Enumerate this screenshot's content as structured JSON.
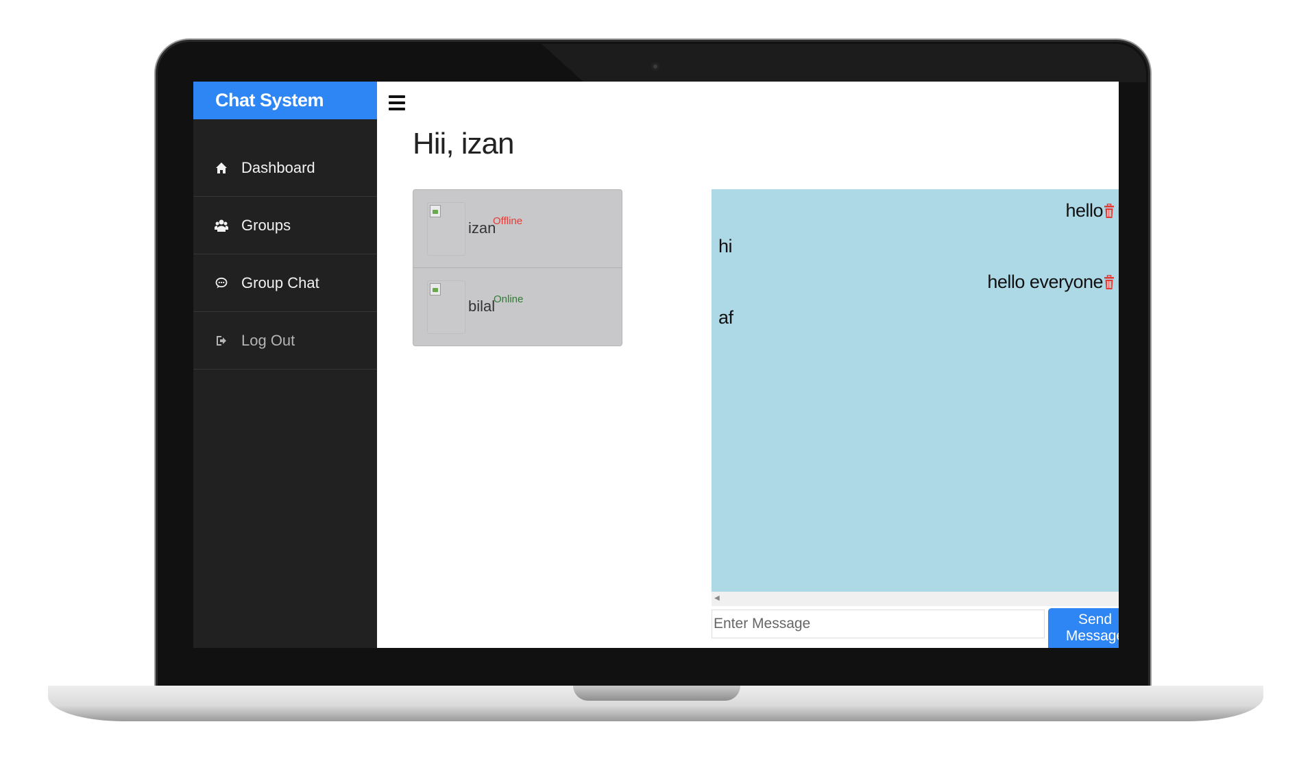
{
  "app": {
    "brand": "Chat System",
    "accent_color": "#2e86f5",
    "sidebar_color": "#212121",
    "chat_bg_color": "#add8e6"
  },
  "sidebar": {
    "items": [
      {
        "label": "Dashboard",
        "icon": "home-icon"
      },
      {
        "label": "Groups",
        "icon": "users-icon"
      },
      {
        "label": "Group Chat",
        "icon": "chat-bubble-icon"
      },
      {
        "label": "Log Out",
        "icon": "logout-icon"
      }
    ]
  },
  "header": {
    "menu_icon": "hamburger-icon",
    "greeting": "Hii, izan"
  },
  "users": [
    {
      "name": "izan",
      "status": "Offline",
      "status_color": "#e53935"
    },
    {
      "name": "bilal",
      "status": "Online",
      "status_color": "#2e7d32"
    }
  ],
  "messages": [
    {
      "text": "hello",
      "side": "right",
      "actions": [
        "trash-icon",
        "edit-icon"
      ]
    },
    {
      "text": "hi",
      "side": "left"
    },
    {
      "text": "hello everyone",
      "side": "right",
      "actions": [
        "trash-icon",
        "edit-icon"
      ]
    },
    {
      "text": "af",
      "side": "left"
    }
  ],
  "composer": {
    "placeholder": "Enter Message",
    "value": "",
    "send_label": "Send Message"
  }
}
